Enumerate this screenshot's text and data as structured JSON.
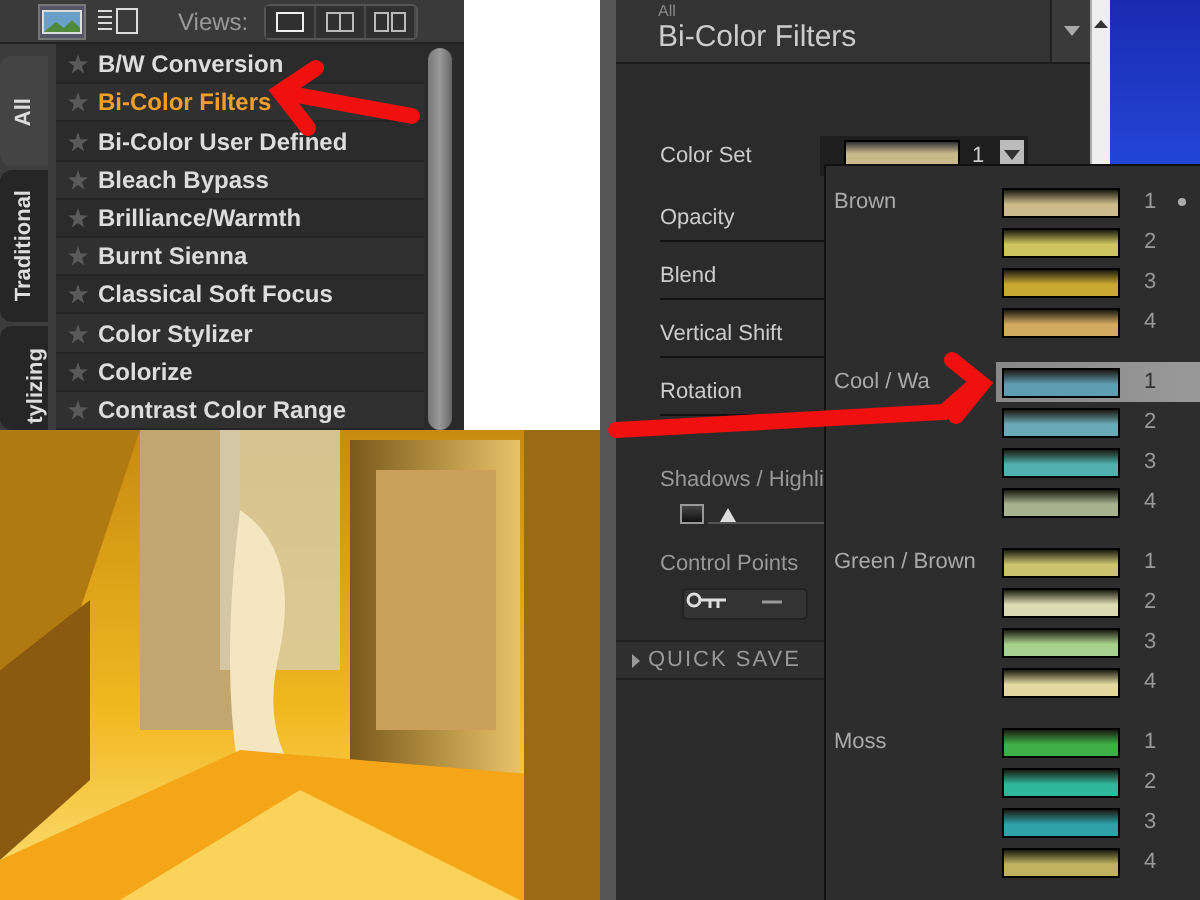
{
  "filter_browser": {
    "views_label": "Views:",
    "category_tabs": [
      {
        "label": "All",
        "selected": true
      },
      {
        "label": "Traditional",
        "selected": false
      },
      {
        "label": "tylizing",
        "selected": false
      }
    ],
    "filters": [
      {
        "label": "B/W Conversion",
        "selected": false
      },
      {
        "label": "Bi-Color Filters",
        "selected": true
      },
      {
        "label": "Bi-Color User Defined",
        "selected": false
      },
      {
        "label": "Bleach Bypass",
        "selected": false
      },
      {
        "label": "Brilliance/Warmth",
        "selected": false
      },
      {
        "label": "Burnt Sienna",
        "selected": false
      },
      {
        "label": "Classical Soft Focus",
        "selected": false
      },
      {
        "label": "Color Stylizer",
        "selected": false
      },
      {
        "label": "Colorize",
        "selected": false
      },
      {
        "label": "Contrast Color Range",
        "selected": false
      }
    ]
  },
  "filter_panel": {
    "category": "All",
    "title": "Bi-Color Filters",
    "color_set": {
      "label": "Color Set",
      "color": "#c8b88a",
      "value": "1"
    },
    "controls": [
      {
        "label": "Opacity"
      },
      {
        "label": "Blend"
      },
      {
        "label": "Vertical Shift"
      },
      {
        "label": "Rotation"
      }
    ],
    "shadows": {
      "label": "Shadows / Highli",
      "level": 0.1
    },
    "control_points_label": "Control Points",
    "quick_save": "QUICK SAVE"
  },
  "color_set_menu": [
    {
      "label": "Brown",
      "options": [
        {
          "number": "1",
          "color": "#cdbb8c",
          "selected": false,
          "current": true
        },
        {
          "number": "2",
          "color": "#cfc55e",
          "selected": false,
          "current": false
        },
        {
          "number": "3",
          "color": "#caa832",
          "selected": false,
          "current": false
        },
        {
          "number": "4",
          "color": "#d4aa62",
          "selected": false,
          "current": false
        }
      ]
    },
    {
      "label": "Cool / Wa",
      "options": [
        {
          "number": "1",
          "color": "#5f9db3",
          "selected": true,
          "current": false
        },
        {
          "number": "2",
          "color": "#6aaab8",
          "selected": false,
          "current": false
        },
        {
          "number": "3",
          "color": "#4fb0ae",
          "selected": false,
          "current": false
        },
        {
          "number": "4",
          "color": "#a9b28f",
          "selected": false,
          "current": false
        }
      ]
    },
    {
      "label": "Green / Brown",
      "options": [
        {
          "number": "1",
          "color": "#cbc36f",
          "selected": false,
          "current": false
        },
        {
          "number": "2",
          "color": "#dcdab2",
          "selected": false,
          "current": false
        },
        {
          "number": "3",
          "color": "#a9d18e",
          "selected": false,
          "current": false
        },
        {
          "number": "4",
          "color": "#e2d8a0",
          "selected": false,
          "current": false
        }
      ]
    },
    {
      "label": "Moss",
      "options": [
        {
          "number": "1",
          "color": "#3fb045",
          "selected": false,
          "current": false
        },
        {
          "number": "2",
          "color": "#2fb99a",
          "selected": false,
          "current": false
        },
        {
          "number": "3",
          "color": "#2ea1a9",
          "selected": false,
          "current": false
        },
        {
          "number": "4",
          "color": "#c1b262",
          "selected": false,
          "current": false
        }
      ]
    }
  ]
}
